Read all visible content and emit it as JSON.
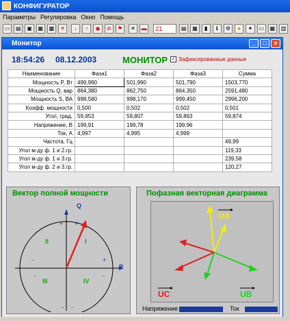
{
  "app": {
    "title": "КОНФИГУРАТОР",
    "menu": [
      "Параметры",
      "Регулировка",
      "Окно",
      "Помощь"
    ],
    "toolbar_value": "21"
  },
  "window": {
    "title": "Монитор",
    "time": "18:54:26",
    "date": "08.12.2003",
    "mode": "МОНИТОР",
    "fixed_checked": "✓",
    "fixed_label": "Зафиксированные данные"
  },
  "table": {
    "headers": [
      "Наименование",
      "Фаза1",
      "Фаза2",
      "Фаза3",
      "Сумма"
    ],
    "rows": [
      [
        "Мощность P, Вт",
        "499,990",
        "501,990",
        "501,790",
        "1503,770"
      ],
      [
        "Мощность Q, вар",
        "864,380",
        "862,750",
        "864,350",
        "2591,480"
      ],
      [
        "Мощность S, ВА",
        "998,580",
        "998,170",
        "999,450",
        "2996,200"
      ],
      [
        "Коэфф. мощности",
        "0,500",
        "0,502",
        "0,502",
        "0,501"
      ],
      [
        "Угол, град.",
        "59,953",
        "59,807",
        "59,863",
        "59,874"
      ],
      [
        "Напряжение, В",
        "199,91",
        "199,78",
        "199,96",
        ""
      ],
      [
        "Ток, А",
        "4,997",
        "4,995",
        "4,999",
        ""
      ],
      [
        "Частота, Гц",
        "",
        "",
        "",
        "49,99"
      ],
      [
        "Угол м-ду ф. 1 и 2.гр.",
        "",
        "",
        "",
        "119,33"
      ],
      [
        "Угол м-ду ф. 1 и 3.гр.",
        "",
        "",
        "",
        "239,58"
      ],
      [
        "Угол м-ду ф. 2 и 3.гр.",
        "",
        "",
        "",
        "120,27"
      ]
    ]
  },
  "left_panel": {
    "title": "Вектор полной мощности",
    "axis_q": "Q",
    "axis_p": "P",
    "quadrants": [
      "I",
      "II",
      "III",
      "IV"
    ],
    "plus": "+",
    "minus": "-"
  },
  "right_panel": {
    "title": "Пофазная векторная диаграмма",
    "labels": [
      "UA",
      "UB",
      "UC"
    ],
    "legend_voltage": "Напряжение",
    "legend_current": "Ток"
  },
  "colors": {
    "ua": "#f0f000",
    "ub": "#20d020",
    "uc": "#e02020",
    "vector": "#e02020",
    "axis": "#1a3aa0"
  }
}
